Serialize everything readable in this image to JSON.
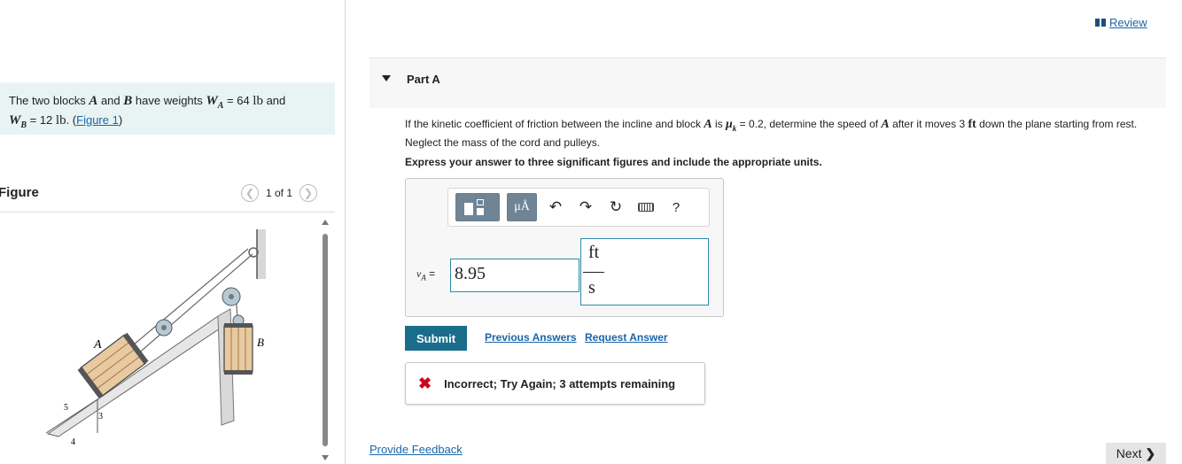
{
  "problem": {
    "text_1": "The two blocks ",
    "block_a": "A",
    "text_2": " and ",
    "block_b": "B",
    "text_3": " have weights ",
    "wa_sym": "W",
    "wa_sub": "A",
    "wa_val": " = 64 ",
    "wa_unit": "lb",
    "text_4": " and",
    "wb_sym": "W",
    "wb_sub": "B",
    "wb_val": " = 12 ",
    "wb_unit": "lb",
    "text_5": ". (",
    "figure_link": "Figure 1",
    "text_6": ")"
  },
  "figure_panel": {
    "title": "Figure",
    "pager_text": "1 of 1",
    "prev_icon": "chevron-left-icon",
    "next_icon": "chevron-right-icon",
    "labels": {
      "a": "A",
      "b": "B",
      "slope_h": "5",
      "slope_v": "3",
      "slope_base": "4"
    }
  },
  "header": {
    "review_label": "Review",
    "review_icon": "book-icon"
  },
  "part": {
    "title": "Part A"
  },
  "question": {
    "t1": "If the kinetic coefficient of friction between the incline and block ",
    "a": "A",
    "t2": " is ",
    "mu": "μ",
    "mu_sub": "k",
    "t3": " = 0.2, determine the speed of ",
    "a2": "A",
    "t4": " after it moves 3 ",
    "ft": "ft",
    "t5": " down the plane starting from rest. Neglect the mass of the cord and pulleys.",
    "express": "Express your answer to three significant figures and include the appropriate units."
  },
  "answer": {
    "var_sym": "v",
    "var_sub": "A",
    "equals": " =",
    "value": "8.95",
    "unit_num": "ft",
    "unit_den": "s",
    "toolbar": {
      "units_button": "μÅ",
      "help": "?",
      "icons": [
        "templates-icon",
        "units-icon",
        "undo-icon",
        "redo-icon",
        "reset-icon",
        "keyboard-icon",
        "help-icon"
      ]
    }
  },
  "actions": {
    "submit": "Submit",
    "previous_answers": "Previous Answers",
    "request_answer": "Request Answer"
  },
  "feedback": {
    "icon": "x-icon",
    "message": "Incorrect; Try Again; 3 attempts remaining"
  },
  "footer": {
    "provide_feedback": "Provide Feedback",
    "next": "Next"
  },
  "colors": {
    "accent": "#1a6d8a",
    "link": "#1a66a8",
    "error": "#d0021b",
    "problem_bg": "#e8f4f4"
  }
}
